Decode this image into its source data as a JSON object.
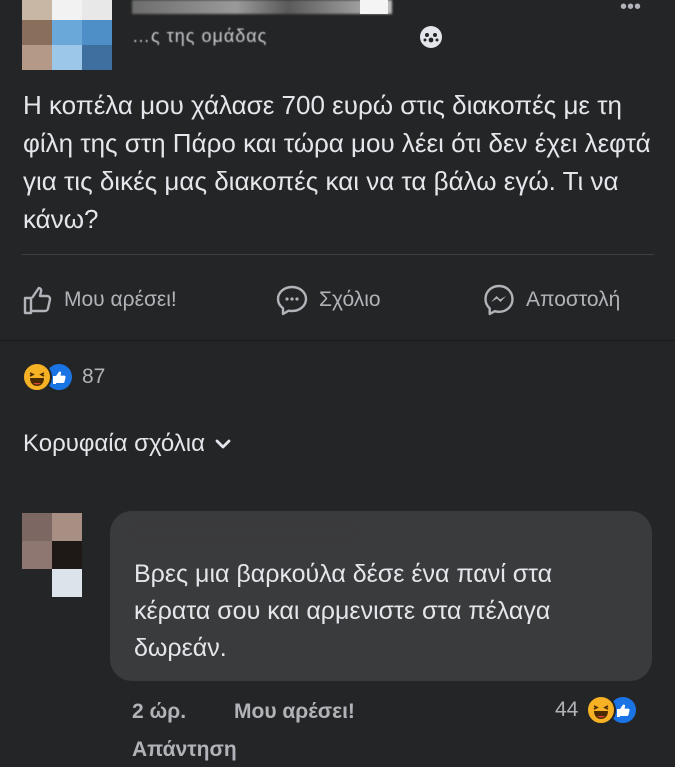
{
  "post": {
    "group_name": "…ς της ομάδας",
    "text": "Η κοπέλα μου χάλασε 700 ευρώ στις διακοπές με τη φίλη της στη Πάρο και τώρα μου λέει ότι δεν έχει λεφτά για τις δικές μας διακοπές και να τα βάλω εγώ. Τι να κάνω?"
  },
  "actions": {
    "like": "Μου αρέσει!",
    "comment": "Σχόλιο",
    "send": "Αποστολή"
  },
  "reactions": {
    "icons": [
      "haha-icon",
      "like-icon"
    ],
    "count": "87"
  },
  "comments_filter": {
    "label": "Κορυφαία σχόλια"
  },
  "comment": {
    "text": "Βρες μια βαρκούλα δέσε ένα πανί στα κέρατα σου και αρμενιστε στα πέλαγα δωρεάν.",
    "time": "2 ώρ.",
    "like": "Μου αρέσει!",
    "reply": "Απάντηση",
    "reaction_count": "44"
  },
  "colors": {
    "background": "#242526",
    "bubble": "#3a3b3c",
    "text": "#e4e6eb",
    "secondary": "#b0b3b8",
    "haha": "#f7b125",
    "like": "#1b74e4"
  }
}
